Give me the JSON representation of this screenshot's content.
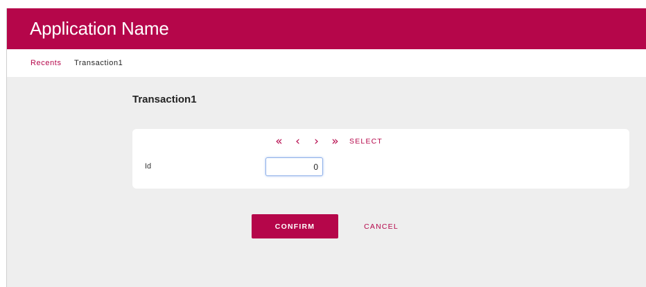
{
  "header": {
    "app_name": "Application Name"
  },
  "breadcrumb": {
    "recents": "Recents",
    "current": "Transaction1"
  },
  "page": {
    "title": "Transaction1"
  },
  "navigator": {
    "first_icon": "«",
    "prev_icon": "‹",
    "next_icon": "›",
    "last_icon": "»",
    "select_label": "SELECT"
  },
  "form": {
    "id_label": "Id",
    "id_value": "0"
  },
  "actions": {
    "confirm_label": "CONFIRM",
    "cancel_label": "CANCEL"
  },
  "colors": {
    "brand": "#b5064a",
    "background": "#eeeeee"
  }
}
